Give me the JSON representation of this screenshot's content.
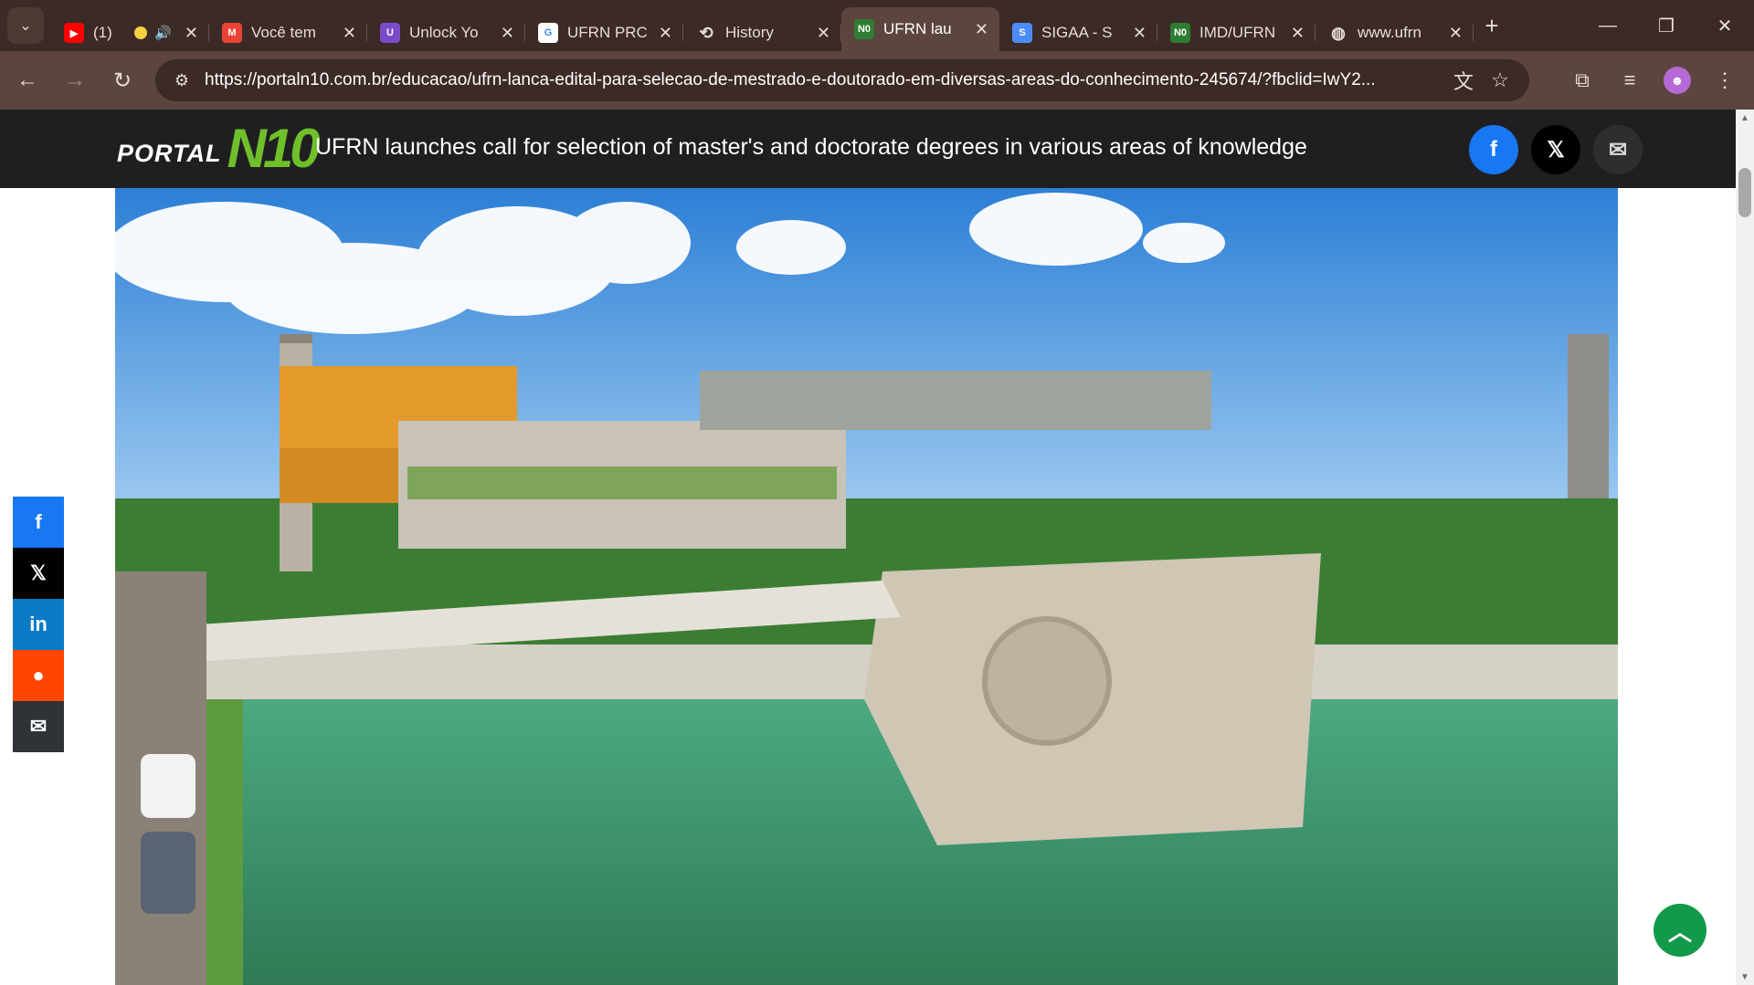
{
  "browser": {
    "tabs": [
      {
        "title": "(1)",
        "favicon": "youtube-icon",
        "color": "#ff0000",
        "glyph": "▶",
        "active": false
      },
      {
        "title": "Você tem",
        "favicon": "gmail-icon",
        "color": "#ea4335",
        "glyph": "M",
        "active": false
      },
      {
        "title": "Unlock Yo",
        "favicon": "unlock-app-icon",
        "color": "#7b4bc9",
        "glyph": "U",
        "active": false
      },
      {
        "title": "UFRN PRC",
        "favicon": "google-icon",
        "color": "#ffffff",
        "glyph": "G",
        "active": false
      },
      {
        "title": "History",
        "favicon": "history-icon",
        "color": "#e8dcd7",
        "glyph": "⟲",
        "active": false
      },
      {
        "title": "UFRN lau",
        "favicon": "portal-n10-favicon",
        "color": "#2e7d32",
        "glyph": "N0",
        "active": true
      },
      {
        "title": "SIGAA - S",
        "favicon": "sigaa-icon",
        "color": "#4b8df8",
        "glyph": "S",
        "active": false
      },
      {
        "title": "IMD/UFRN",
        "favicon": "portal-n10-favicon",
        "color": "#2e7d32",
        "glyph": "N0",
        "active": false
      },
      {
        "title": "www.ufrn",
        "favicon": "globe-icon",
        "color": "#e8dcd7",
        "glyph": "◍",
        "active": false
      }
    ],
    "url": "https://portaln10.com.br/educacao/ufrn-lanca-edital-para-selecao-de-mestrado-e-doutorado-em-diversas-areas-do-conhecimento-245674/?fbclid=IwY2..."
  },
  "site": {
    "logo_text": "PORTAL",
    "logo_mark": "N10",
    "headline": "UFRN launches call for selection of master's and doctorate degrees in various areas of knowledge"
  },
  "colors": {
    "header_bg": "#1f1f22",
    "facebook": "#1877f2",
    "linkedin": "#0a7ac4",
    "reddit": "#ff4500",
    "back_to_top": "#129a4a",
    "logo_green": "#6fbf2a"
  }
}
